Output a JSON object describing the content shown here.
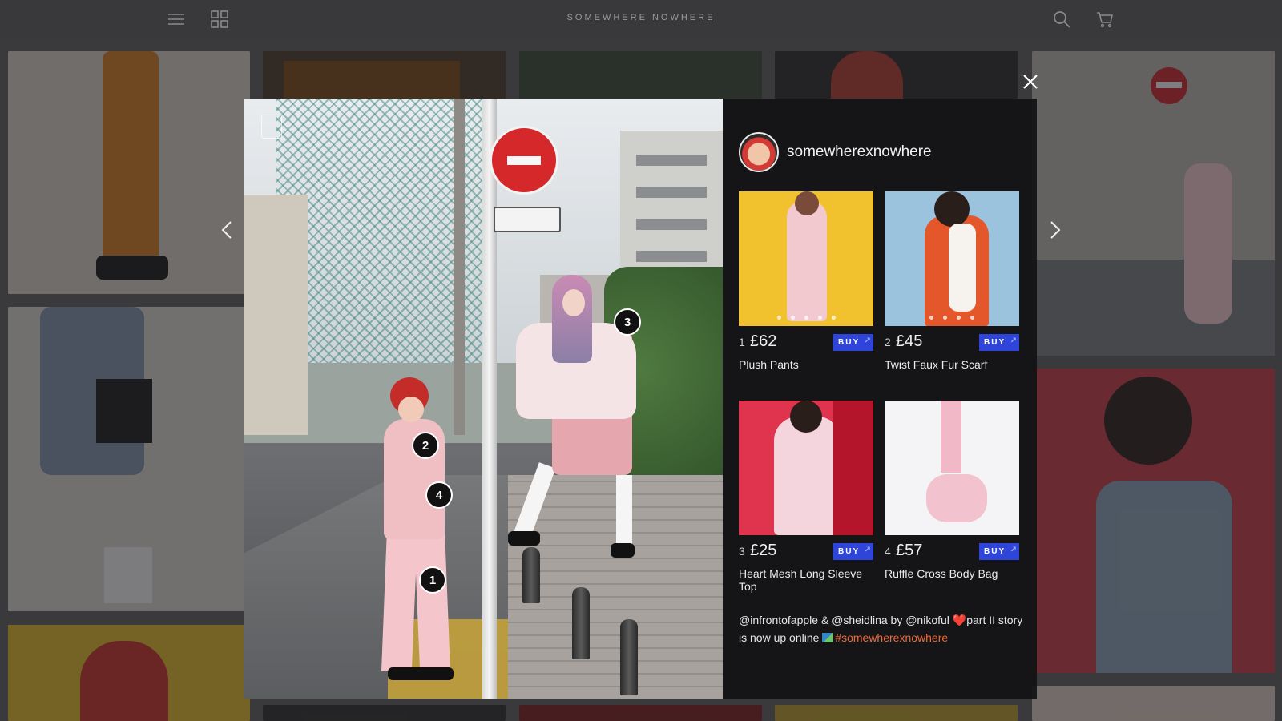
{
  "site": {
    "brand": "SOMEWHERE NOWHERE",
    "icons": [
      "menu-icon",
      "grid-icon",
      "search-icon",
      "cart-icon"
    ]
  },
  "modal": {
    "username": "somewherexnowhere",
    "hotspots": [
      "1",
      "2",
      "3",
      "4"
    ],
    "products": [
      {
        "index": "1",
        "price": "£62",
        "name": "Plush Pants",
        "buy_label": "BUY",
        "color": "#f2c12e"
      },
      {
        "index": "2",
        "price": "£45",
        "name": "Twist Faux Fur Scarf",
        "buy_label": "BUY",
        "color": "#9cc3de"
      },
      {
        "index": "3",
        "price": "£25",
        "name": "Heart Mesh Long Sleeve Top",
        "buy_label": "BUY",
        "color": "#e0334e"
      },
      {
        "index": "4",
        "price": "£57",
        "name": "Ruffle Cross Body Bag",
        "buy_label": "BUY",
        "color": "#f4f4f6"
      }
    ],
    "caption": {
      "text1": "@infrontofapple & @sheidlina by @nikoful ",
      "heart": "❤️",
      "text2": "part II story is now up online ",
      "hashtag": "#somewherexnowhere"
    }
  },
  "colors": {
    "buy_button": "#2f44d8",
    "hashtag": "#f06a3a",
    "overlay": "#3a3a3c"
  }
}
